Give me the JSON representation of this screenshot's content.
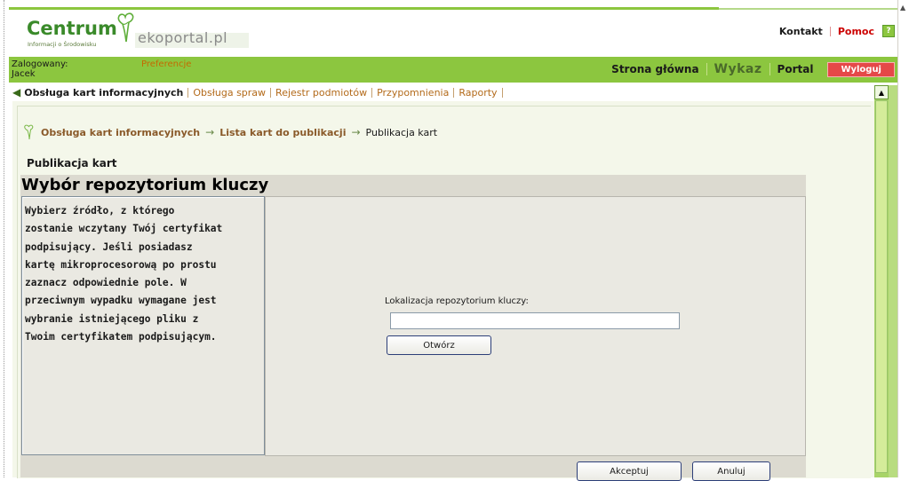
{
  "header": {
    "logo_main": "Centrum",
    "logo_sub": "Informacji o Środowisku",
    "logo_portal": "ekoportal.pl",
    "links": {
      "kontakt": "Kontakt",
      "pomoc": "Pomoc",
      "help_icon_glyph": "?"
    }
  },
  "userbar": {
    "logged_label": "Zalogowany:",
    "user_name": "Jacek",
    "preferences": "Preferencje",
    "nav": {
      "home": "Strona główna",
      "wykaz": "Wykaz",
      "portal": "Portal",
      "logout": "Wyloguj"
    }
  },
  "tabs": [
    {
      "label": "Obsługa kart informacyjnych",
      "active": true
    },
    {
      "label": "Obsługa spraw"
    },
    {
      "label": "Rejestr podmiotów"
    },
    {
      "label": "Przypomnienia"
    },
    {
      "label": "Raporty"
    }
  ],
  "breadcrumb": {
    "items": [
      "Obsługa kart informacyjnych",
      "Lista kart do publikacji"
    ],
    "arrow": "→",
    "current": "Publikacja kart"
  },
  "page_title": "Publikacja kart",
  "panel": {
    "title": "Wybór repozytorium kluczy",
    "description": "Wybierz źródło, z którego\nzostanie wczytany Twój certyfikat\npodpisujący. Jeśli posiadasz\nkartę mikroprocesorową po prostu\nzaznacz odpowiednie pole. W\nprzeciwnym wypadku wymagane jest\nwybranie istniejącego pliku z\nTwoim certyfikatem podpisującym.",
    "location_label": "Lokalizacja repozytorium kluczy:",
    "location_value": "",
    "open_button": "Otwórz",
    "accept_button": "Akceptuj",
    "cancel_button": "Anuluj"
  },
  "colors": {
    "brand_green": "#8cc63f",
    "logout_red": "#e54848",
    "link_brown": "#8a5a2a"
  },
  "icons": {
    "back": "back-arrow-icon",
    "breadcrumb": "tree-icon",
    "help": "help-icon",
    "scroll_up": "scroll-up-arrow-icon"
  }
}
